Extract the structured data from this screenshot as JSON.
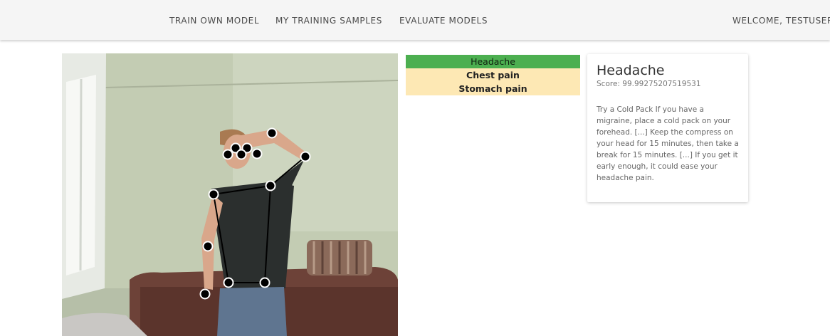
{
  "nav": {
    "links": [
      {
        "label": "TRAIN OWN MODEL"
      },
      {
        "label": "MY TRAINING SAMPLES"
      },
      {
        "label": "EVALUATE MODELS"
      }
    ],
    "welcome": "WELCOME, TESTUSER"
  },
  "predictions": {
    "items": [
      {
        "label": "Headache",
        "state": "active"
      },
      {
        "label": "Chest pain",
        "state": "inactive"
      },
      {
        "label": "Stomach pain",
        "state": "inactive"
      }
    ],
    "colors": {
      "active": "#4caf50",
      "inactive": "#fde8b4"
    }
  },
  "result": {
    "title": "Headache",
    "score": "Score: 99.99275207519531",
    "advice": "Try a Cold Pack If you have a migraine, place a cold pack on your forehead. [...] Keep the compress on your head for 15 minutes, then take a break for 15 minutes. [...] If you get it early enough, it could ease your headache pain."
  }
}
